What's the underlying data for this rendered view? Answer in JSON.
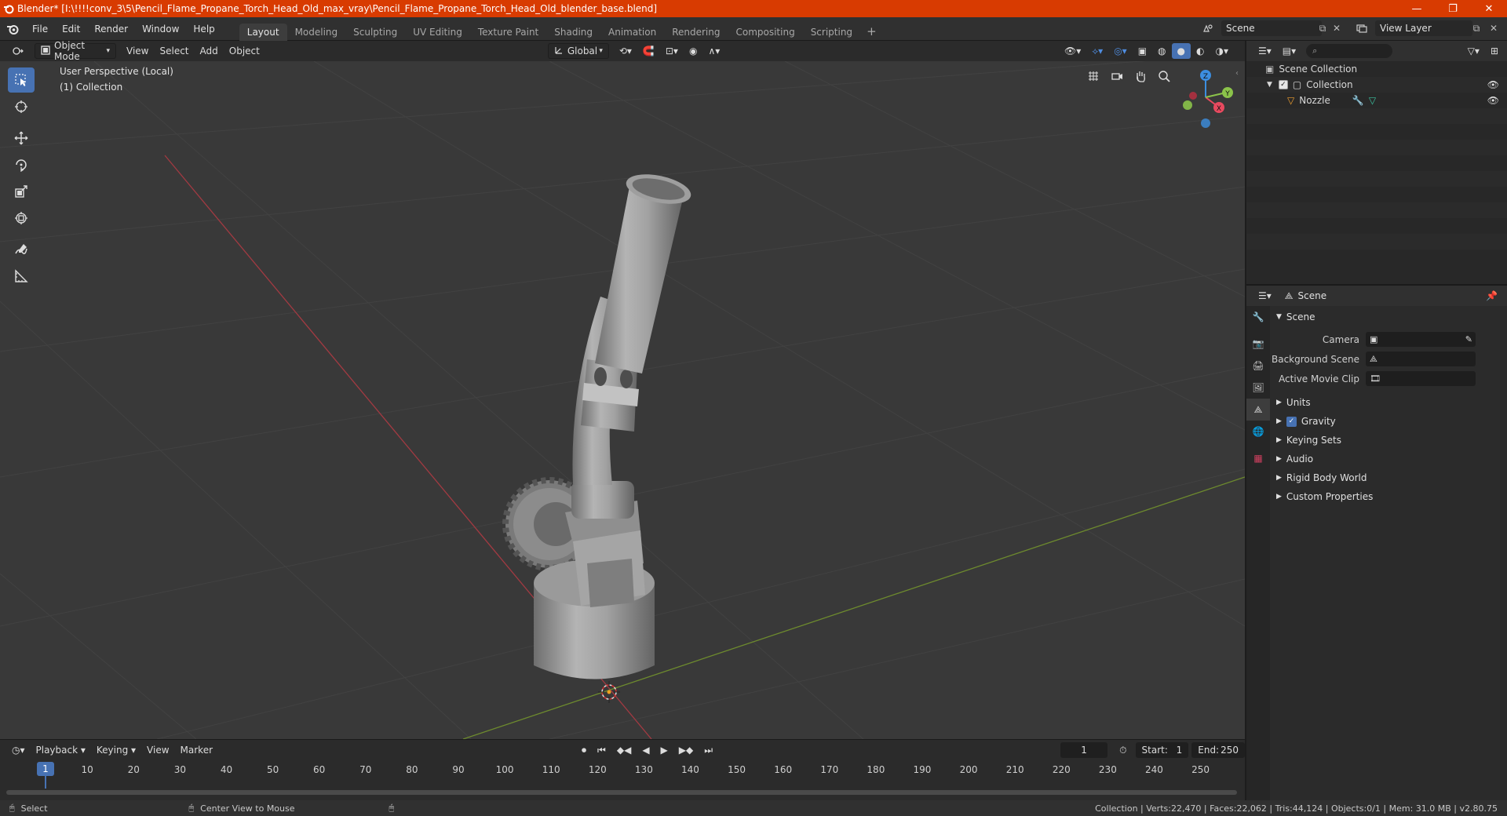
{
  "title": "Blender* [I:\\!!!!conv_3\\5\\Pencil_Flame_Propane_Torch_Head_Old_max_vray\\Pencil_Flame_Propane_Torch_Head_Old_blender_base.blend]",
  "menu": [
    "File",
    "Edit",
    "Render",
    "Window",
    "Help"
  ],
  "workspaces": [
    "Layout",
    "Modeling",
    "Sculpting",
    "UV Editing",
    "Texture Paint",
    "Shading",
    "Animation",
    "Rendering",
    "Compositing",
    "Scripting"
  ],
  "active_workspace": "Layout",
  "scene_name": "Scene",
  "view_layer": "View Layer",
  "viewport": {
    "mode": "Object Mode",
    "menus": [
      "View",
      "Select",
      "Add",
      "Object"
    ],
    "orientation": "Global",
    "perspective_label": "User Perspective (Local)",
    "collection_label": "(1) Collection",
    "gizmo_axes": {
      "x": "X",
      "y": "Y",
      "z": "Z"
    }
  },
  "outliner": {
    "scene_collection": "Scene Collection",
    "collection": "Collection",
    "object": "Nozzle"
  },
  "properties": {
    "header": "Scene",
    "section": "Scene",
    "fields": [
      {
        "label": "Camera",
        "value": ""
      },
      {
        "label": "Background Scene",
        "value": ""
      },
      {
        "label": "Active Movie Clip",
        "value": ""
      }
    ],
    "panels": [
      "Units",
      "Gravity",
      "Keying Sets",
      "Audio",
      "Rigid Body World",
      "Custom Properties"
    ],
    "gravity_checked": true
  },
  "timeline": {
    "menus": [
      "Playback",
      "Keying",
      "View",
      "Marker"
    ],
    "current_frame": "1",
    "start_label": "Start:",
    "start": "1",
    "end_label": "End:",
    "end": "250",
    "ruler": [
      "1",
      "10",
      "20",
      "30",
      "40",
      "50",
      "60",
      "70",
      "80",
      "90",
      "100",
      "110",
      "120",
      "130",
      "140",
      "150",
      "160",
      "170",
      "180",
      "190",
      "200",
      "210",
      "220",
      "230",
      "240",
      "250"
    ]
  },
  "status": {
    "select": "Select",
    "center_view": "Center View to Mouse",
    "stats": "Collection | Verts:22,470 | Faces:22,062 | Tris:44,124 | Objects:0/1 | Mem: 31.0 MB | v2.80.75"
  },
  "colors": {
    "accent": "#4772b3",
    "titlebar": "#d83b01",
    "x_axis": "#e84a5f",
    "y_axis": "#8bc34a",
    "z_axis": "#3c8ee0"
  }
}
